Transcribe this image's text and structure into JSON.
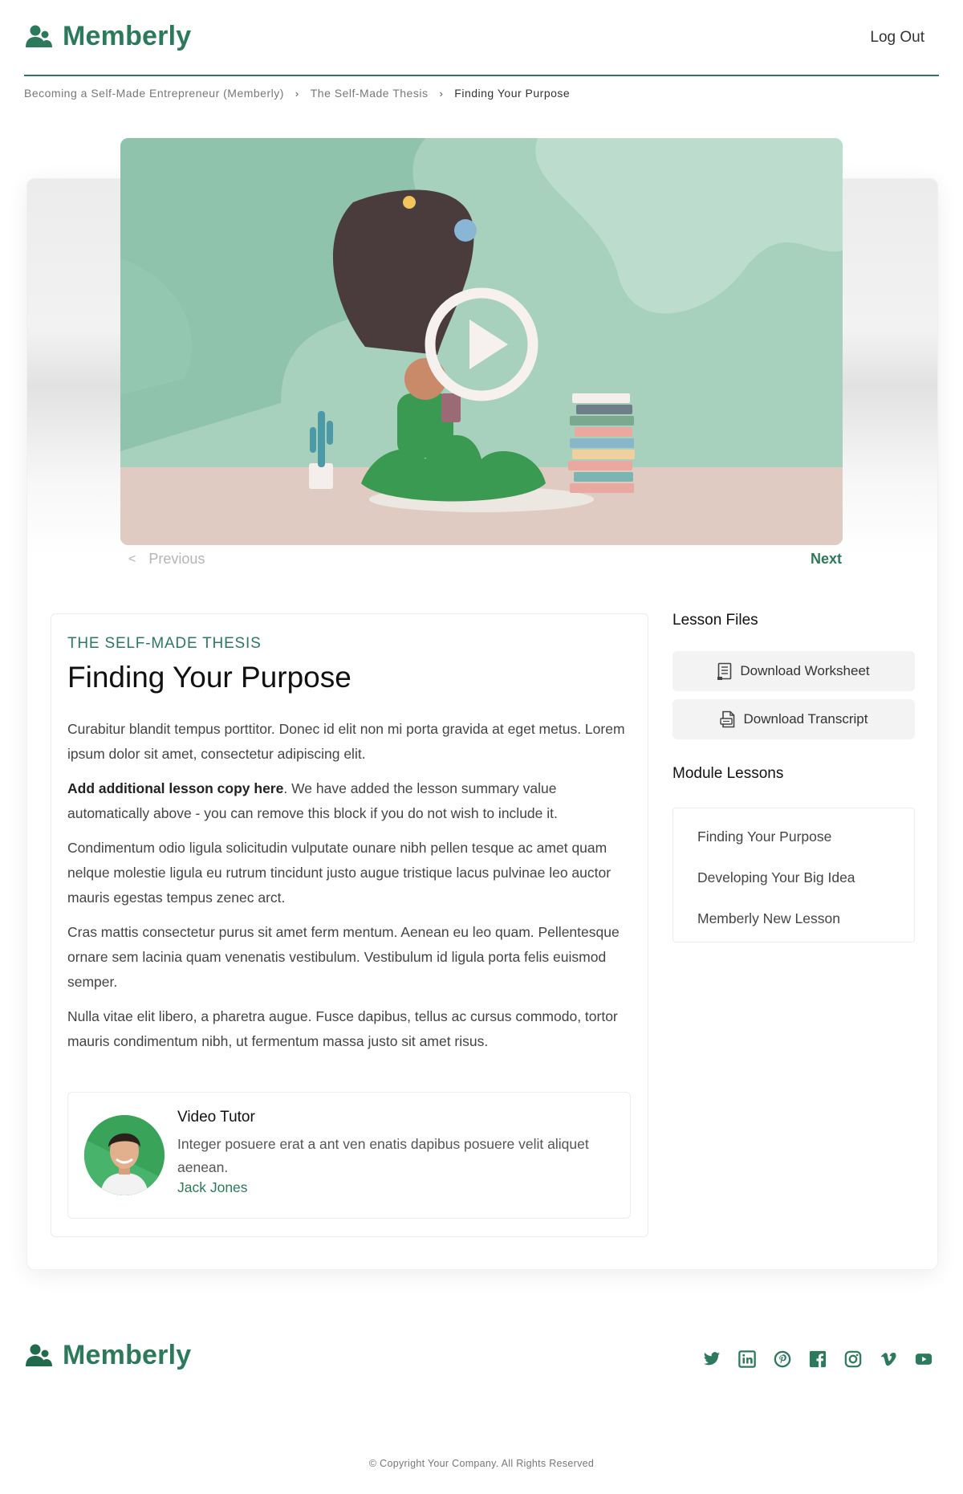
{
  "header": {
    "brand": "Memberly",
    "logout_label": "Log Out"
  },
  "breadcrumb": {
    "items": [
      "Becoming a Self-Made Entrepreneur (Memberly)",
      "The Self-Made Thesis",
      "Finding Your Purpose"
    ]
  },
  "video": {
    "thumbnail": "video-thumbnail-illustration",
    "play_icon": "play-icon"
  },
  "pager": {
    "previous_label": "Previous",
    "next_label": "Next"
  },
  "lesson": {
    "kicker": "THE SELF-MADE THESIS",
    "title": "Finding Your Purpose",
    "p1": "Curabitur blandit tempus porttitor. Donec id elit non mi porta gravida at eget metus. Lorem ipsum dolor sit amet, consectetur adipiscing elit.",
    "p2_bold": "Add additional lesson copy here",
    "p2_rest": ".  We have added the lesson summary value automatically above - you can remove this block if you do not wish to include it.",
    "p3": "Condimentum odio ligula solicitudin vulputate ounare nibh pellen tesque ac amet quam nelque molestie ligula eu rutrum tincidunt justo augue tristique lacus pulvinae leo auctor mauris egestas tempus zenec arct.",
    "p4": "Cras mattis consectetur purus sit amet ferm mentum. Aenean eu leo quam. Pellentesque ornare sem lacinia quam venenatis vestibulum. Vestibulum id ligula porta felis euismod semper.",
    "p5": "Nulla vitae elit libero, a pharetra augue. Fusce dapibus, tellus ac cursus commodo, tortor mauris condimentum nibh, ut fermentum massa justo sit amet risus."
  },
  "tutor": {
    "heading": "Video Tutor",
    "description": "Integer posuere erat a ant ven enatis dapibus posuere velit aliquet aenean.",
    "name": "Jack Jones"
  },
  "sidebar": {
    "files_heading": "Lesson Files",
    "files": [
      {
        "label": "Download Worksheet",
        "icon": "document-icon"
      },
      {
        "label": "Download Transcript",
        "icon": "pdf-file-icon"
      }
    ],
    "lessons_heading": "Module Lessons",
    "lessons": [
      "Finding Your Purpose",
      "Developing Your Big Idea",
      "Memberly New Lesson"
    ]
  },
  "footer": {
    "brand": "Memberly",
    "social_icons": [
      "twitter-icon",
      "linkedin-icon",
      "pinterest-icon",
      "facebook-icon",
      "instagram-icon",
      "vimeo-icon",
      "youtube-icon"
    ],
    "copyright": "© Copyright Your Company.  All Rights Reserved"
  },
  "colors": {
    "brand": "#2c7a5b",
    "video_bg": "#a9d3bf",
    "muted_text": "#777777"
  }
}
